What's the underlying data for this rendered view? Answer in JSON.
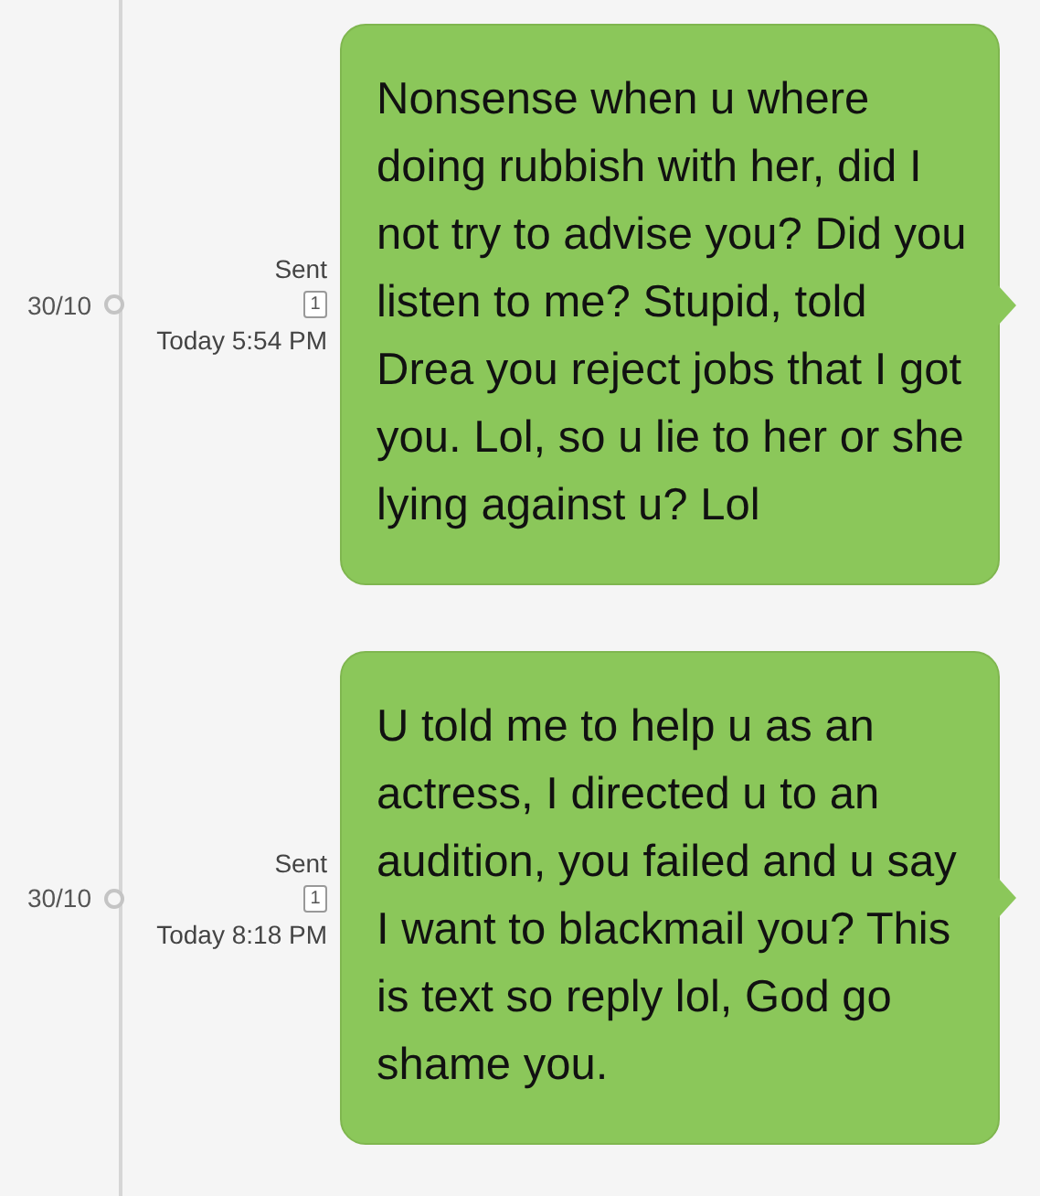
{
  "messages": [
    {
      "date": "30/10",
      "status": "Sent",
      "count": "1",
      "time": "Today 5:54 PM",
      "text": "Nonsense when u where doing rubbish with her, did I not try to advise you? Did you listen to me? Stupid, told Drea you reject jobs that I got you. Lol, so u lie to her or she lying against u? Lol"
    },
    {
      "date": "30/10",
      "status": "Sent",
      "count": "1",
      "time": "Today 8:18 PM",
      "text": "U told me to help u as an actress, I directed u to an audition, you failed and u say I want to blackmail you? This is text so reply lol, God go shame you."
    }
  ]
}
